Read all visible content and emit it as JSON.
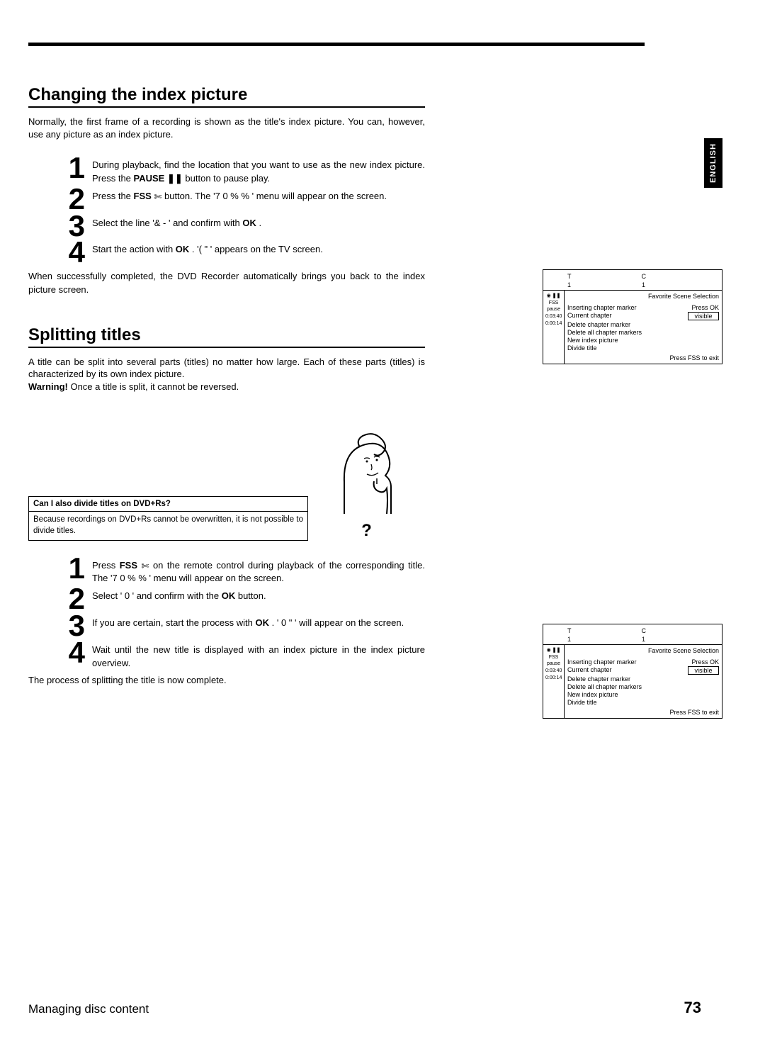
{
  "lang_tab": "ENGLISH",
  "section1": {
    "title": "Changing the index picture",
    "intro": "Normally, the first frame of a recording is shown as the title's index picture. You can, however, use any picture as an index picture.",
    "step1_a": "During playback, find the location that you want to use as the new index picture. Press the ",
    "step1_pause_label": "PAUSE",
    "step1_pause_icon": "❚❚",
    "step1_b": " button to pause play.",
    "step2_a": "Press the ",
    "step2_fss": "FSS",
    "step2_scissor": "✄",
    "step2_b": " button. The '7  0       %       %        ' menu will appear on the screen.",
    "step3_a": "Select the line '&   -                             ' and confirm with ",
    "step3_ok": "OK",
    "step3_b": " .",
    "step4_a": "Start the action with ",
    "step4_ok": "OK",
    "step4_b": " . '(              \"           ' appears on the TV screen.",
    "after": "When successfully completed, the DVD Recorder automatically brings you back to the index picture screen."
  },
  "section2": {
    "title": "Splitting titles",
    "intro_a": "A title can be split into several parts (titles) no matter how large. Each of these parts (titles) is characterized by its own index picture.",
    "intro_warn_label": "Warning!",
    "intro_warn_b": " Once a title is split, it cannot be reversed.",
    "qbox_title": "Can I also divide titles on DVD+Rs?",
    "qbox_body": "Because recordings on DVD+Rs cannot be overwritten, it is not possible to divide titles.",
    "qmark": "?",
    "step1_a": "Press ",
    "step1_fss": "FSS",
    "step1_scissor": "✄",
    "step1_b": " on the remote control during playback of the corresponding title. The '7  0       %       %          ' menu will appear on the screen.",
    "step2_a": "Select '    0            ' and confirm with the ",
    "step2_ok": "OK",
    "step2_b": " button.",
    "step3_a": "If you are certain, start the process with ",
    "step3_ok": "OK",
    "step3_b": " . '   0         \"        ' will appear on the screen.",
    "step4": "Wait until the new title is displayed with an index picture in the index picture overview.",
    "after": "The process of splitting the title is now complete."
  },
  "osd": {
    "t": "T",
    "c": "C",
    "one": "1",
    "fss_header": "Favorite Scene Selection",
    "ic_play": "▶",
    "ic_pause": "❚❚",
    "ic_line1": "FSS  pause",
    "ic_line2": "0:03:40",
    "ic_line3": "0:00:14",
    "r1_label": "Inserting chapter marker",
    "r1_val": "Press OK",
    "r2_label": "Current chapter",
    "r2_val": "visible",
    "r3_label": "Delete chapter marker",
    "r4_label": "Delete all chapter markers",
    "r5_label": "New index picture",
    "r6_label": "Divide title",
    "footer": "Press FSS to exit"
  },
  "footer": {
    "left": "Managing disc content",
    "right": "73"
  }
}
